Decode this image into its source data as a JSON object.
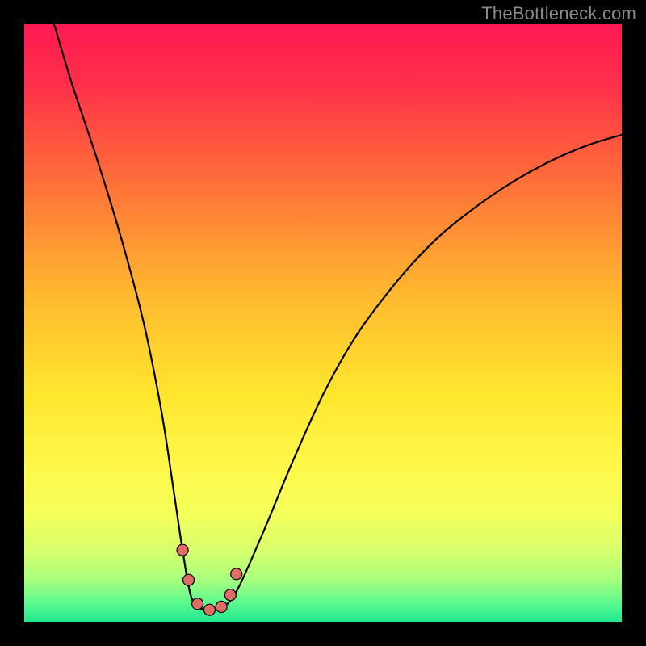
{
  "watermark": "TheBottleneck.com",
  "chart_data": {
    "type": "line",
    "title": "",
    "xlabel": "",
    "ylabel": "",
    "xlim": [
      0,
      100
    ],
    "ylim": [
      0,
      100
    ],
    "curve": {
      "x": [
        5,
        8,
        12,
        16,
        20,
        23,
        25,
        26.5,
        28,
        30,
        32,
        34,
        36,
        40,
        45,
        50,
        55,
        60,
        65,
        70,
        75,
        80,
        85,
        90,
        95,
        100
      ],
      "y": [
        100,
        90,
        78,
        65,
        50,
        35,
        22,
        12,
        4,
        2,
        2,
        3,
        6,
        15,
        27,
        38,
        47,
        54,
        60,
        65,
        69,
        72.5,
        75.5,
        78,
        80,
        81.5
      ]
    },
    "markers": {
      "x": [
        26.5,
        27.5,
        29,
        31,
        33,
        34.5,
        35.5
      ],
      "y": [
        12,
        7,
        3,
        2,
        2.5,
        4.5,
        8
      ]
    },
    "gradient_stops": [
      {
        "offset": 0.0,
        "color": "#ff1a52"
      },
      {
        "offset": 0.1,
        "color": "#ff2f4a"
      },
      {
        "offset": 0.25,
        "color": "#ff6a3a"
      },
      {
        "offset": 0.45,
        "color": "#ffb82f"
      },
      {
        "offset": 0.62,
        "color": "#ffe62e"
      },
      {
        "offset": 0.74,
        "color": "#fff84a"
      },
      {
        "offset": 0.82,
        "color": "#f4ff5a"
      },
      {
        "offset": 0.88,
        "color": "#d8ff6c"
      },
      {
        "offset": 0.93,
        "color": "#a7ff7e"
      },
      {
        "offset": 0.97,
        "color": "#58f98e"
      },
      {
        "offset": 1.0,
        "color": "#20e88f"
      }
    ]
  }
}
